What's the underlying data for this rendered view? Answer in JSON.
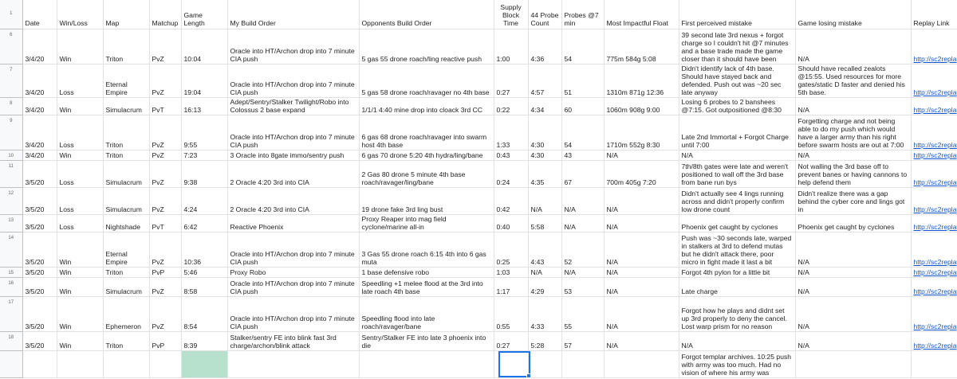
{
  "header": {
    "row_number": "1",
    "date": "Date",
    "win_loss": "Win/Loss",
    "map": "Map",
    "matchup": "Matchup",
    "game_length": "Game Length",
    "my_build": "My Build Order",
    "opp_build": "Opponents Build Order",
    "supply_block": "Supply Block Time",
    "probe44": "44 Probe Count",
    "probes7": "Probes @7 min",
    "float": "Most Impactful Float",
    "first_mistake": "First perceived mistake",
    "losing_mistake": "Game losing mistake",
    "replay": "Replay Link"
  },
  "rows": [
    {
      "rn": "6",
      "date": "3/4/20",
      "result": "Win",
      "map": "Triton",
      "matchup": "PvZ",
      "length": "10:04",
      "my_build": "Oracle into HT/Archon drop  into 7 minute CIA push",
      "opp_build": "5 gas 55 drone roach/ling reactive push",
      "supply": "1:00",
      "p44": "4:36",
      "p7": "54",
      "float": "775m 584g 5:08",
      "first": "39 second late 3rd nexus + forgot charge so I couldn't hit @7 minutes and a base trade made the game closer than it should have been",
      "losing": "N/A",
      "replay": "http://sc2replays"
    },
    {
      "rn": "7",
      "date": "3/4/20",
      "result": "Loss",
      "map": "Eternal Empire",
      "matchup": "PvZ",
      "length": "19:04",
      "my_build": "Oracle into HT/Archon drop into 7 minute CIA push",
      "opp_build": "5 gas 58 drone roach/ravager no 4th base",
      "supply": "0:27",
      "p44": "4:57",
      "p7": "51",
      "float": "1310m 871g 12:36",
      "first": "Didn't identify lack of 4th base. Should have stayed back and defended. Push out was ~20 sec late anyway",
      "losing": "Should have recalled zealots @15:55. Used resources for more gates/static D faster and denied his 5th base.",
      "replay": "http://sc2replays"
    },
    {
      "rn": "8",
      "date": "3/4/20",
      "result": "Win",
      "map": "Simulacrum",
      "matchup": "PvT",
      "length": "16:13",
      "my_build": "Adept/Sentry/Stalker Twilight/Robo into Colossus 2 base expand",
      "opp_build": "1/1/1 4:40 mine drop into cloack 3rd CC",
      "supply": "0:22",
      "p44": "4:34",
      "p7": "60",
      "float": "1060m 908g 9:00",
      "first": "Losing 6 probes to 2 banshees @7:15. Got outpositioned @8:30",
      "losing": "N/A",
      "replay": "http://sc2replays"
    },
    {
      "rn": "9",
      "date": "3/4/20",
      "result": "Loss",
      "map": "Triton",
      "matchup": "PvZ",
      "length": "9:55",
      "my_build": "Oracle into HT/Archon drop into 7 minute CIA push",
      "opp_build": "6 gas 68 drone roach/ravager into swarm host 4th base",
      "supply": "1:33",
      "p44": "4:30",
      "p7": "54",
      "float": "1710m 552g 8:30",
      "first": "Late 2nd Immortal + Forgot Charge until 7:00",
      "losing": "Forgetting charge and not being able to do my push which would have a larger army than his right before swarm hosts are out at 7:00",
      "replay": "http://sc2replays"
    },
    {
      "rn": "10",
      "date": "3/4/20",
      "result": "Win",
      "map": "Triton",
      "matchup": "PvZ",
      "length": "7:23",
      "my_build": "3 Oracle into 8gate immo/sentry push",
      "opp_build": "6 gas 70 drone 5:20 4th hydra/ling/bane",
      "supply": "0:43",
      "p44": "4:30",
      "p7": "43",
      "float": "N/A",
      "first": "N/A",
      "losing": "N/A",
      "replay": "http://sc2replays"
    },
    {
      "rn": "11",
      "date": "3/5/20",
      "result": "Loss",
      "map": "Simulacrum",
      "matchup": "PvZ",
      "length": "9:38",
      "my_build": "2 Oracle 4:20 3rd into CIA",
      "opp_build": "2 Gas 80 drone 5 minute 4th base roach/ravager/ling/bane",
      "supply": "0:24",
      "p44": "4:35",
      "p7": "67",
      "float": "700m 405g 7:20",
      "first": "7th/8th gates were late and weren't positioned to wall off the 3rd base from bane run bys",
      "losing": "Not walling the 3rd base off to prevent banes or having cannons to help defend them",
      "replay": "http://sc2replays"
    },
    {
      "rn": "12",
      "date": "3/5/20",
      "result": "Loss",
      "map": "Simulacrum",
      "matchup": "PvZ",
      "length": "4:24",
      "my_build": "2 Oracle 4:20 3rd into CIA",
      "opp_build": "19 drone fake 3rd ling bust",
      "supply": "0:42",
      "p44": "N/A",
      "p7": "N/A",
      "float": "N/A",
      "first": "Didn't actually see 4 lings running across and didn't properly confirm low drone count",
      "losing": "Didn't realize there was a gap behind the cyber core and lings got in",
      "replay": "http://sc2replays"
    },
    {
      "rn": "13",
      "date": "3/5/20",
      "result": "Loss",
      "map": "Nightshade",
      "matchup": "PvT",
      "length": "6:42",
      "my_build": "Reactive Phoenix",
      "opp_build": "Proxy Reaper into mag field cyclone/marine all-in",
      "supply": "0:40",
      "p44": "5:58",
      "p7": "N/A",
      "float": "N/A",
      "first": "Phoenix get caught by cyclones",
      "losing": "Phoenix get caught by cyclones",
      "replay": "http://sc2replays"
    },
    {
      "rn": "14",
      "date": "3/5/20",
      "result": "Win",
      "map": "Eternal Empire",
      "matchup": "PvZ",
      "length": "10:36",
      "my_build": "Oracle into HT/Archon drop into 7 minute CIA push",
      "opp_build": "3 Gas 55 drone roach 6:15 4th into 6 gas muta",
      "supply": "0:25",
      "p44": "4:43",
      "p7": "52",
      "float": "N/A",
      "first": "Push was ~30 seconds late, warped in stalkers at 3rd to defend mutas but he didn't attack there, poor micro in fight made it last a bit",
      "losing": "N/A",
      "replay": "http://sc2replays"
    },
    {
      "rn": "15",
      "date": "3/5/20",
      "result": "Win",
      "map": "Triton",
      "matchup": "PvP",
      "length": "5:46",
      "my_build": "Proxy Robo",
      "opp_build": "1 base defensive robo",
      "supply": "1:03",
      "p44": "N/A",
      "p7": "N/A",
      "float": "N/A",
      "first": "Forgot 4th pylon for a little bit",
      "losing": "N/A",
      "replay": "http://sc2replays"
    },
    {
      "rn": "16",
      "date": "3/5/20",
      "result": "Win",
      "map": "Simulacrum",
      "matchup": "PvZ",
      "length": "8:58",
      "my_build": "Oracle into HT/Archon drop into 7 minute CIA push",
      "opp_build": "Speedling +1 melee flood at the 3rd into late roach 4th base",
      "supply": "1:17",
      "p44": "4:29",
      "p7": "53",
      "float": "N/A",
      "first": "Late charge",
      "losing": "N/A",
      "replay": "http://sc2replays"
    },
    {
      "rn": "17",
      "date": "3/5/20",
      "result": "Win",
      "map": "Ephemeron",
      "matchup": "PvZ",
      "length": "8:54",
      "my_build": "Oracle into HT/Archon drop into 7 minute CIA push",
      "opp_build": "Speedling flood into late roach/ravager/bane",
      "supply": "0:55",
      "p44": "4:33",
      "p7": "55",
      "float": "N/A",
      "first": "Forgot how he plays and didnt set up 3rd properly to deny the cancel. Lost warp prism for no reason",
      "losing": "N/A",
      "replay": "http://sc2replays"
    },
    {
      "rn": "18",
      "date": "3/5/20",
      "result": "Win",
      "map": "Triton",
      "matchup": "PvP",
      "length": "8:39",
      "my_build": "Stalker/sentry FE into blink fast 3rd charge/archon/blink attack",
      "opp_build": "Sentry/Stalker FE into late 3 phoenix into die",
      "supply": "0:27",
      "p44": "5:28",
      "p7": "57",
      "float": "N/A",
      "first": "N/A",
      "losing": "N/A",
      "replay": "http://sc2replays"
    },
    {
      "rn": "",
      "date": "",
      "result": "",
      "map": "",
      "matchup": "",
      "length": "",
      "my_build": "",
      "opp_build": "",
      "supply": "",
      "p44": "",
      "p7": "",
      "float": "",
      "first": "Forgot templar archives. 10:25 push with army was too much. Had no vision of where his army was",
      "losing": "",
      "replay": ""
    }
  ]
}
